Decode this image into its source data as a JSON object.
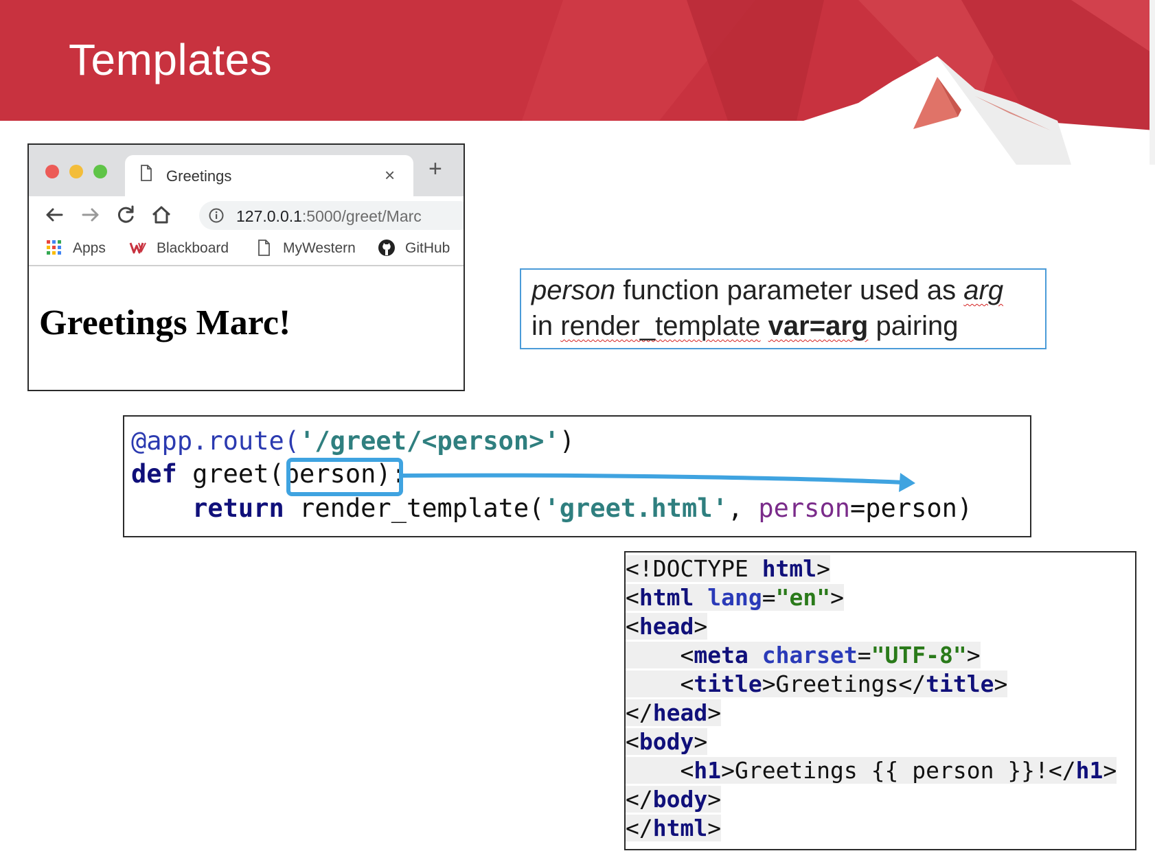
{
  "slide": {
    "title": "Templates",
    "colors": {
      "banner": "#c8323f",
      "accent_blue": "#3fa3e0"
    }
  },
  "browser": {
    "tab_title": "Greetings",
    "tab_close": "×",
    "new_tab": "+",
    "url_host": "127.0.0.1",
    "url_rest": ":5000/greet/Marc",
    "bookmarks": [
      {
        "label": "Apps",
        "icon": "apps-grid-icon"
      },
      {
        "label": "Blackboard",
        "icon": "blackboard-logo-icon"
      },
      {
        "label": "MyWestern",
        "icon": "document-icon"
      },
      {
        "label": "GitHub",
        "icon": "github-icon"
      }
    ],
    "page_heading": "Greetings Marc!"
  },
  "callout": {
    "line1": {
      "italic1": "person",
      "text1": " function parameter used as ",
      "italic2": "arg"
    },
    "line2": {
      "text1": "in ",
      "text2": "render_template",
      "text3": " ",
      "bold": "var=arg",
      "text4": " pairing"
    }
  },
  "python_code": {
    "l1": {
      "decorator": "@app.route(",
      "string": "'/greet/<person>'",
      "end": ")"
    },
    "l2": {
      "kw": "def",
      "mid": " greet(",
      "param": "person",
      "end": "):"
    },
    "l3": {
      "indent": "    ",
      "kw": "return",
      "mid": " render_template(",
      "string": "'greet.html'",
      "comma": ", ",
      "kwarg": "person",
      "end": "=person)"
    }
  },
  "html_code": {
    "lines": [
      "<!DOCTYPE html>",
      "<html lang=\"en\">",
      "<head>",
      "    <meta charset=\"UTF-8\">",
      "    <title>Greetings</title>",
      "</head>",
      "<body>",
      "    <h1>Greetings {{ person }}!</h1>",
      "</body>",
      "</html>"
    ]
  }
}
